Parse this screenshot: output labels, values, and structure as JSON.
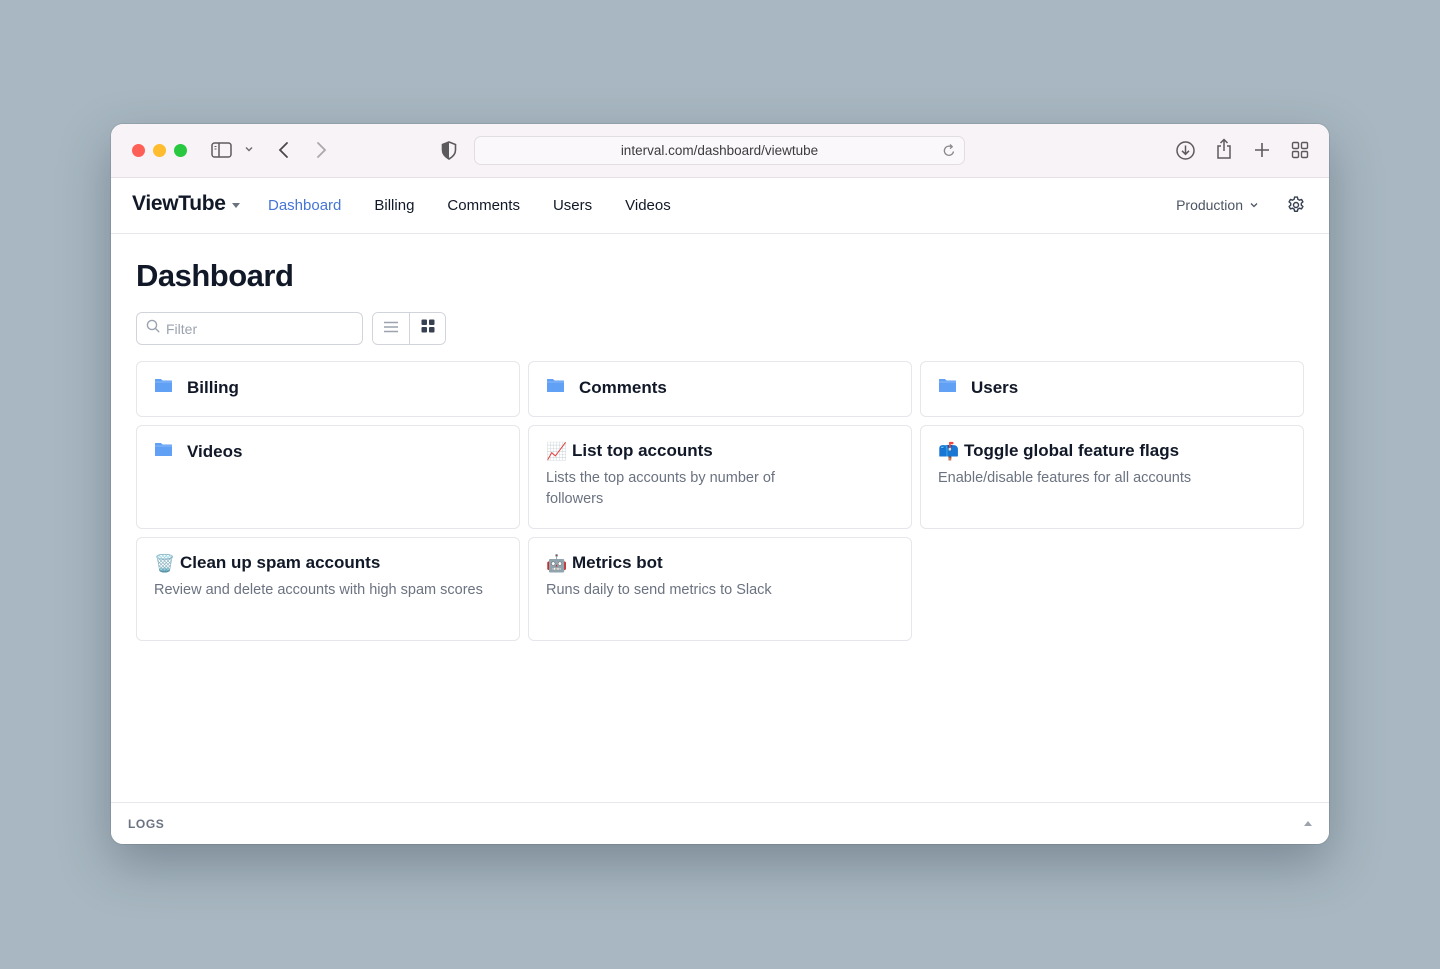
{
  "browser": {
    "url": "interval.com/dashboard/viewtube",
    "icons": [
      "sidebar-icon",
      "chevron-down-icon",
      "back-icon",
      "forward-icon",
      "shield-icon",
      "reload-icon",
      "download-icon",
      "share-icon",
      "new-tab-icon",
      "tab-overview-icon"
    ]
  },
  "nav": {
    "brand": "ViewTube",
    "links": [
      {
        "label": "Dashboard",
        "active": true
      },
      {
        "label": "Billing",
        "active": false
      },
      {
        "label": "Comments",
        "active": false
      },
      {
        "label": "Users",
        "active": false
      },
      {
        "label": "Videos",
        "active": false
      }
    ],
    "environment": "Production",
    "accent_color": "#4575d6"
  },
  "main": {
    "title": "Dashboard",
    "filter_placeholder": "Filter",
    "filter_value": "",
    "view_mode": "grid",
    "cards": [
      {
        "type": "folder",
        "icon": "folder-icon",
        "title": "Billing"
      },
      {
        "type": "folder",
        "icon": "folder-icon",
        "title": "Comments"
      },
      {
        "type": "folder",
        "icon": "folder-icon",
        "title": "Users"
      },
      {
        "type": "folder",
        "icon": "folder-icon",
        "title": "Videos"
      },
      {
        "type": "action",
        "emoji": "📈",
        "icon": "chart-increasing-icon",
        "title": "List top accounts",
        "description": "Lists the top accounts by number of followers"
      },
      {
        "type": "action",
        "emoji": "📫",
        "icon": "mailbox-icon",
        "title": "Toggle global feature flags",
        "description": "Enable/disable features for all accounts"
      },
      {
        "type": "action",
        "emoji": "🗑️",
        "icon": "wastebasket-icon",
        "title": "Clean up spam accounts",
        "description": "Review and delete accounts with high spam scores"
      },
      {
        "type": "action",
        "emoji": "🤖",
        "icon": "robot-icon",
        "title": "Metrics bot",
        "description": "Runs daily to send metrics to Slack"
      }
    ]
  },
  "logs": {
    "label": "LOGS"
  }
}
